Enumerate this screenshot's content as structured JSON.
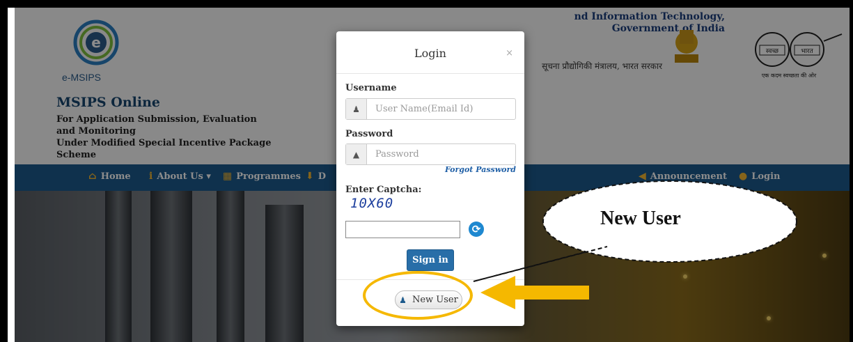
{
  "header": {
    "logo_text": "e-MSIPS",
    "site_title": "MSIPS Online",
    "site_subtitle_1": "For Application Submission, Evaluation and Monitoring",
    "site_subtitle_2": "Under Modified Special Incentive Package Scheme",
    "ministry_line_1": "nd Information Technology,",
    "ministry_line_2": "Government of India",
    "ministry_hindi": "सूचना प्रौद्योगिकी मंत्रालय, भारत सरकार",
    "swachh_left": "स्वच्छ",
    "swachh_right": "भारत",
    "swachh_tagline": "एक कदम स्वच्छता की ओर"
  },
  "nav": {
    "home": "Home",
    "about": "About Us ▾",
    "programmes": "Programmes",
    "partial": "D",
    "announcement": "Announcement",
    "login": "Login"
  },
  "modal": {
    "title": "Login",
    "close": "×",
    "username_label": "Username",
    "username_placeholder": "User Name(Email Id)",
    "password_label": "Password",
    "password_placeholder": "Password",
    "forgot": "Forgot Password",
    "captcha_label": "Enter Captcha:",
    "captcha_text": "10X60",
    "signin": "Sign in",
    "new_user": "New User"
  },
  "annotation": {
    "callout": "New User",
    "highlight_color": "#f5b800"
  }
}
